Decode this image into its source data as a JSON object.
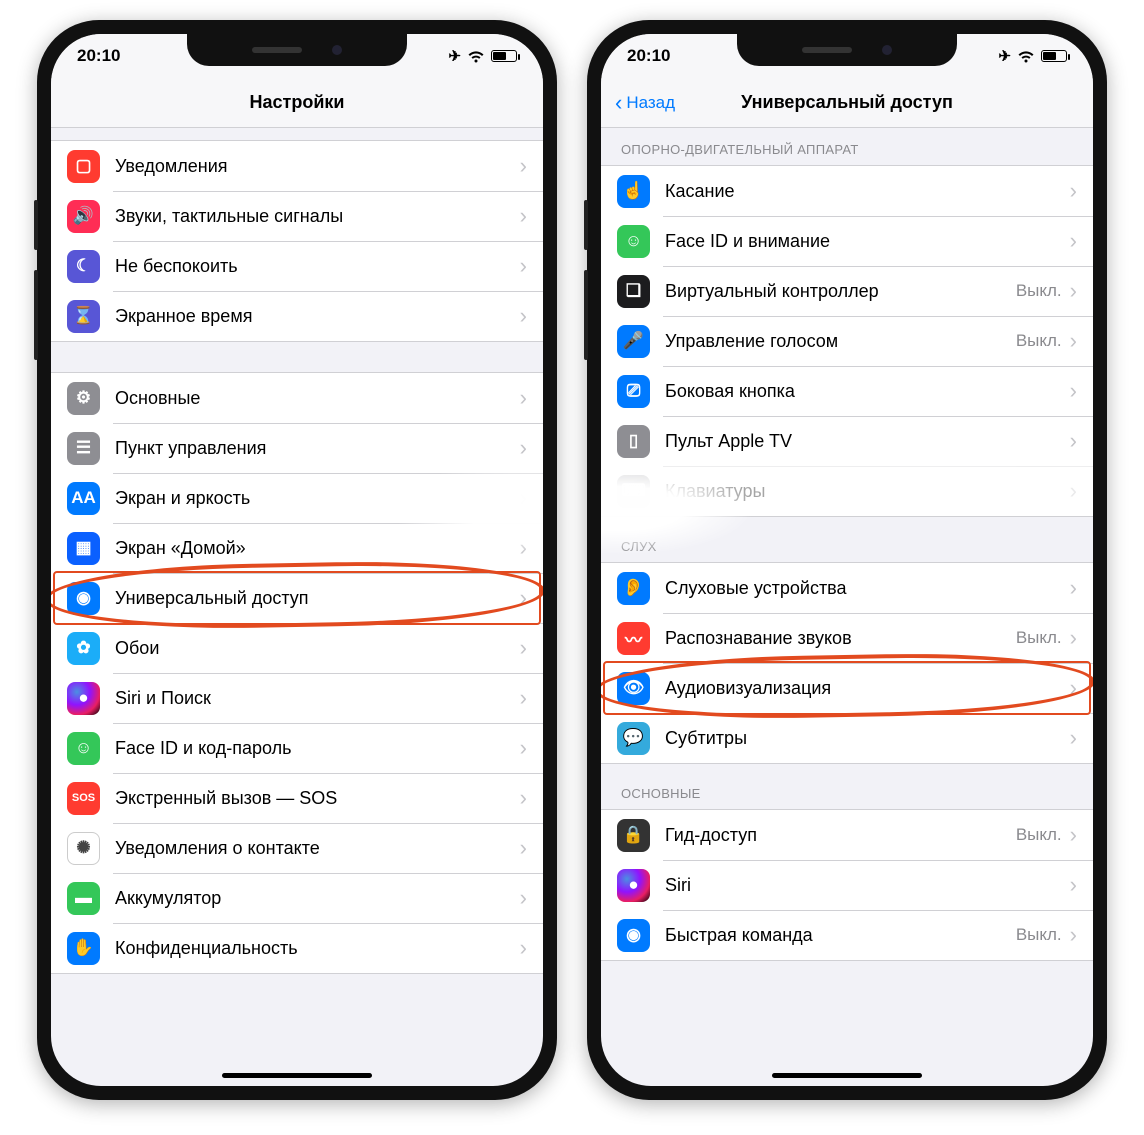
{
  "status": {
    "time": "20:10"
  },
  "off_label": "Выкл.",
  "left": {
    "title": "Настройки",
    "group1": [
      {
        "name": "notifications",
        "label": "Уведомления",
        "icon": "notifications-icon",
        "cls": "ic-red"
      },
      {
        "name": "sounds",
        "label": "Звуки, тактильные сигналы",
        "icon": "speaker-icon",
        "cls": "ic-red2"
      },
      {
        "name": "dnd",
        "label": "Не беспокоить",
        "icon": "moon-icon",
        "cls": "ic-purp"
      },
      {
        "name": "screen-time",
        "label": "Экранное время",
        "icon": "hourglass-icon",
        "cls": "ic-purp"
      }
    ],
    "group2": [
      {
        "name": "general",
        "label": "Основные",
        "icon": "gear-icon",
        "cls": "ic-grey"
      },
      {
        "name": "control-center",
        "label": "Пункт управления",
        "icon": "switches-icon",
        "cls": "ic-grey2"
      },
      {
        "name": "display",
        "label": "Экран и яркость",
        "icon": "text-size-icon",
        "cls": "ic-blue"
      },
      {
        "name": "home-screen",
        "label": "Экран «Домой»",
        "icon": "grid-icon",
        "cls": "ic-dblue"
      },
      {
        "name": "accessibility",
        "label": "Универсальный доступ",
        "icon": "accessibility-icon",
        "cls": "ic-blue",
        "highlight": true
      },
      {
        "name": "wallpaper",
        "label": "Обои",
        "icon": "flower-icon",
        "cls": "ic-cyan"
      },
      {
        "name": "siri",
        "label": "Siri и Поиск",
        "icon": "siri-icon",
        "cls": "ic-siri"
      },
      {
        "name": "faceid",
        "label": "Face ID и код-пароль",
        "icon": "faceid-icon",
        "cls": "ic-green"
      },
      {
        "name": "sos",
        "label": "Экстренный вызов — SOS",
        "icon": "sos-icon",
        "cls": "ic-red"
      },
      {
        "name": "exposure",
        "label": "Уведомления о контакте",
        "icon": "virus-icon",
        "cls": "ic-white"
      },
      {
        "name": "battery",
        "label": "Аккумулятор",
        "icon": "battery-icon",
        "cls": "ic-green"
      },
      {
        "name": "privacy",
        "label": "Конфиденциальность",
        "icon": "hand-icon",
        "cls": "ic-blue"
      }
    ]
  },
  "right": {
    "back": "Назад",
    "title": "Универсальный доступ",
    "sec_motor": "ОПОРНО-ДВИГАТЕЛЬНЫЙ АППАРАТ",
    "sec_hearing": "СЛУХ",
    "sec_general": "ОСНОВНЫЕ",
    "motor": [
      {
        "name": "touch",
        "label": "Касание",
        "icon": "touch-icon",
        "cls": "ic-blue"
      },
      {
        "name": "face-attention",
        "label": "Face ID и внимание",
        "icon": "face-icon",
        "cls": "ic-green"
      },
      {
        "name": "switch-control",
        "label": "Виртуальный контроллер",
        "icon": "switch-icon",
        "cls": "ic-black",
        "detail": "off"
      },
      {
        "name": "voice-control",
        "label": "Управление голосом",
        "icon": "voice-icon",
        "cls": "ic-blue",
        "detail": "off"
      },
      {
        "name": "side-button",
        "label": "Боковая кнопка",
        "icon": "side-button-icon",
        "cls": "ic-blue"
      },
      {
        "name": "apple-tv-remote",
        "label": "Пульт Apple TV",
        "icon": "remote-icon",
        "cls": "ic-grey"
      },
      {
        "name": "keyboards",
        "label": "Клавиатуры",
        "icon": "keyboard-icon",
        "cls": "ic-grey",
        "faded": true
      }
    ],
    "hearing": [
      {
        "name": "hearing-devices",
        "label": "Слуховые устройства",
        "icon": "ear-icon",
        "cls": "ic-blue"
      },
      {
        "name": "sound-recognition",
        "label": "Распознавание звуков",
        "icon": "wave-icon",
        "cls": "ic-red",
        "detail": "off"
      },
      {
        "name": "audio-visual",
        "label": "Аудиовизуализация",
        "icon": "speaker-eye-icon",
        "cls": "ic-blue",
        "highlight": true
      },
      {
        "name": "subtitles",
        "label": "Субтитры",
        "icon": "subtitles-icon",
        "cls": "ic-blue2"
      }
    ],
    "general": [
      {
        "name": "guided-access",
        "label": "Гид-доступ",
        "icon": "lock-icon",
        "cls": "ic-dark",
        "detail": "off"
      },
      {
        "name": "siri",
        "label": "Siri",
        "icon": "siri-icon",
        "cls": "ic-siri"
      },
      {
        "name": "shortcut",
        "label": "Быстрая команда",
        "icon": "accessibility-icon",
        "cls": "ic-blue",
        "detail": "off"
      }
    ]
  }
}
